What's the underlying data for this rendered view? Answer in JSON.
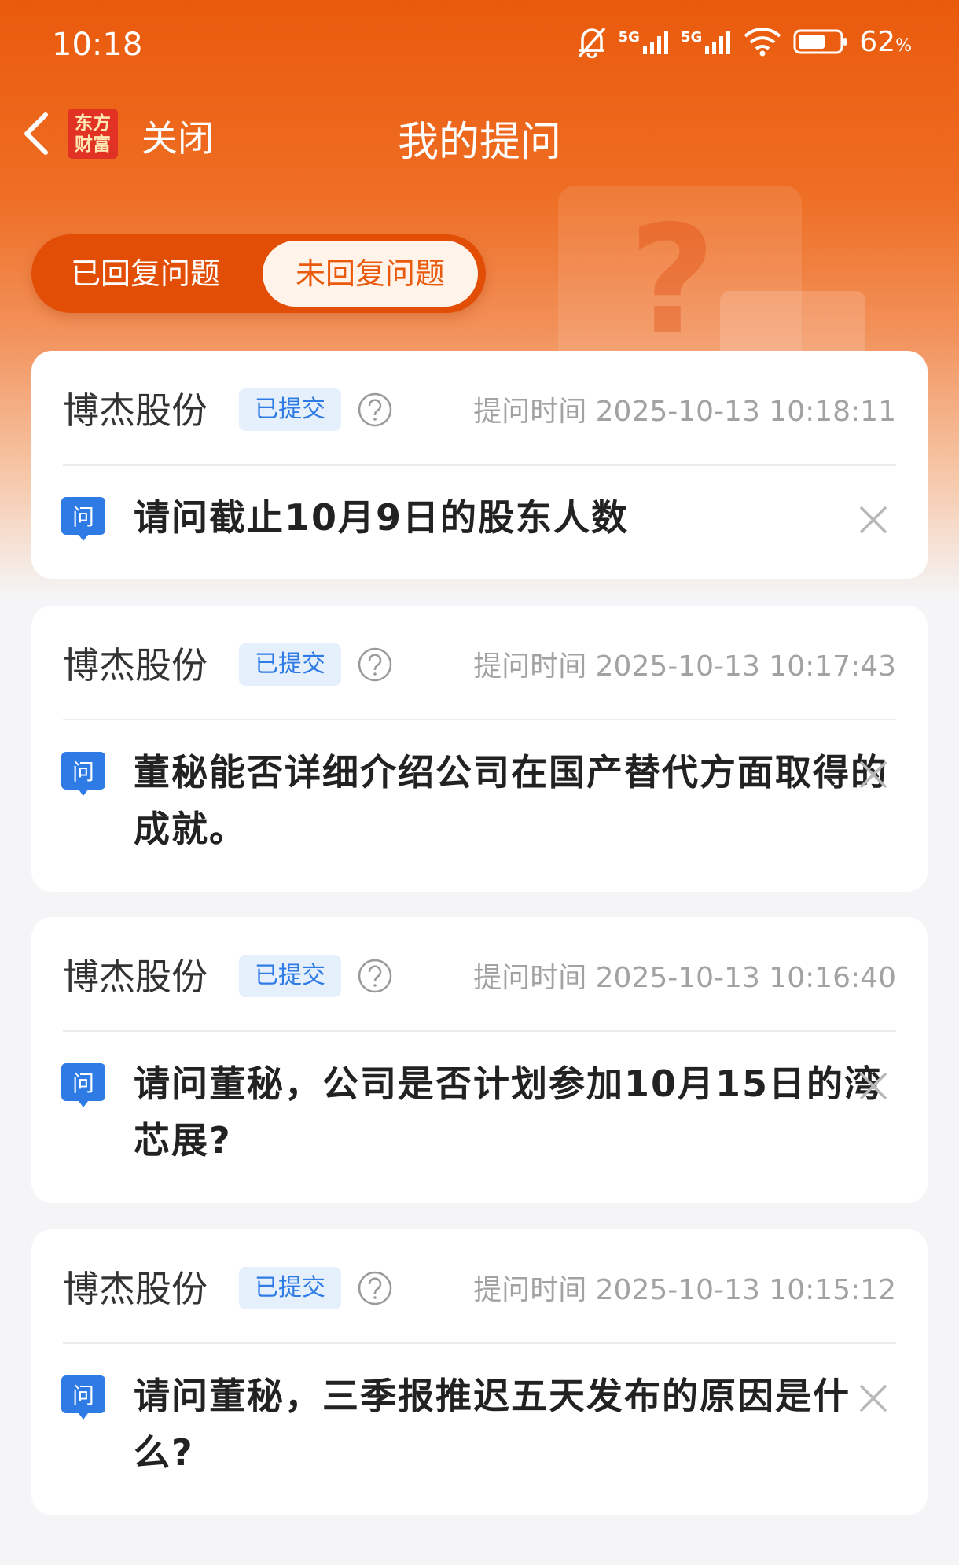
{
  "status_bar": {
    "time": "10:18",
    "network_1": "5G",
    "network_2": "5G",
    "battery": "62",
    "battery_unit": "%"
  },
  "nav": {
    "logo_line1": "东方",
    "logo_line2": "财富",
    "close_label": "关闭",
    "title": "我的提问"
  },
  "tabs": {
    "answered": "已回复问题",
    "unanswered": "未回复问题",
    "active": "unanswered"
  },
  "questions": [
    {
      "company": "博杰股份",
      "status": "已提交",
      "time": "提问时间 2025-10-13 10:18:11",
      "q_icon": "问",
      "text": "请问截止10月9日的股东人数"
    },
    {
      "company": "博杰股份",
      "status": "已提交",
      "time": "提问时间 2025-10-13 10:17:43",
      "q_icon": "问",
      "text": "董秘能否详细介绍公司在国产替代方面取得的成就。"
    },
    {
      "company": "博杰股份",
      "status": "已提交",
      "time": "提问时间 2025-10-13 10:16:40",
      "q_icon": "问",
      "text": "请问董秘，公司是否计划参加10月15日的湾芯展?"
    },
    {
      "company": "博杰股份",
      "status": "已提交",
      "time": "提问时间 2025-10-13 10:15:12",
      "q_icon": "问",
      "text": "请问董秘，三季报推迟五天发布的原因是什么?"
    }
  ],
  "colors": {
    "brand": "#ea5a0c",
    "badge_bg": "#e6f0fd",
    "badge_text": "#2f7be5",
    "q_icon": "#2f7be5"
  }
}
